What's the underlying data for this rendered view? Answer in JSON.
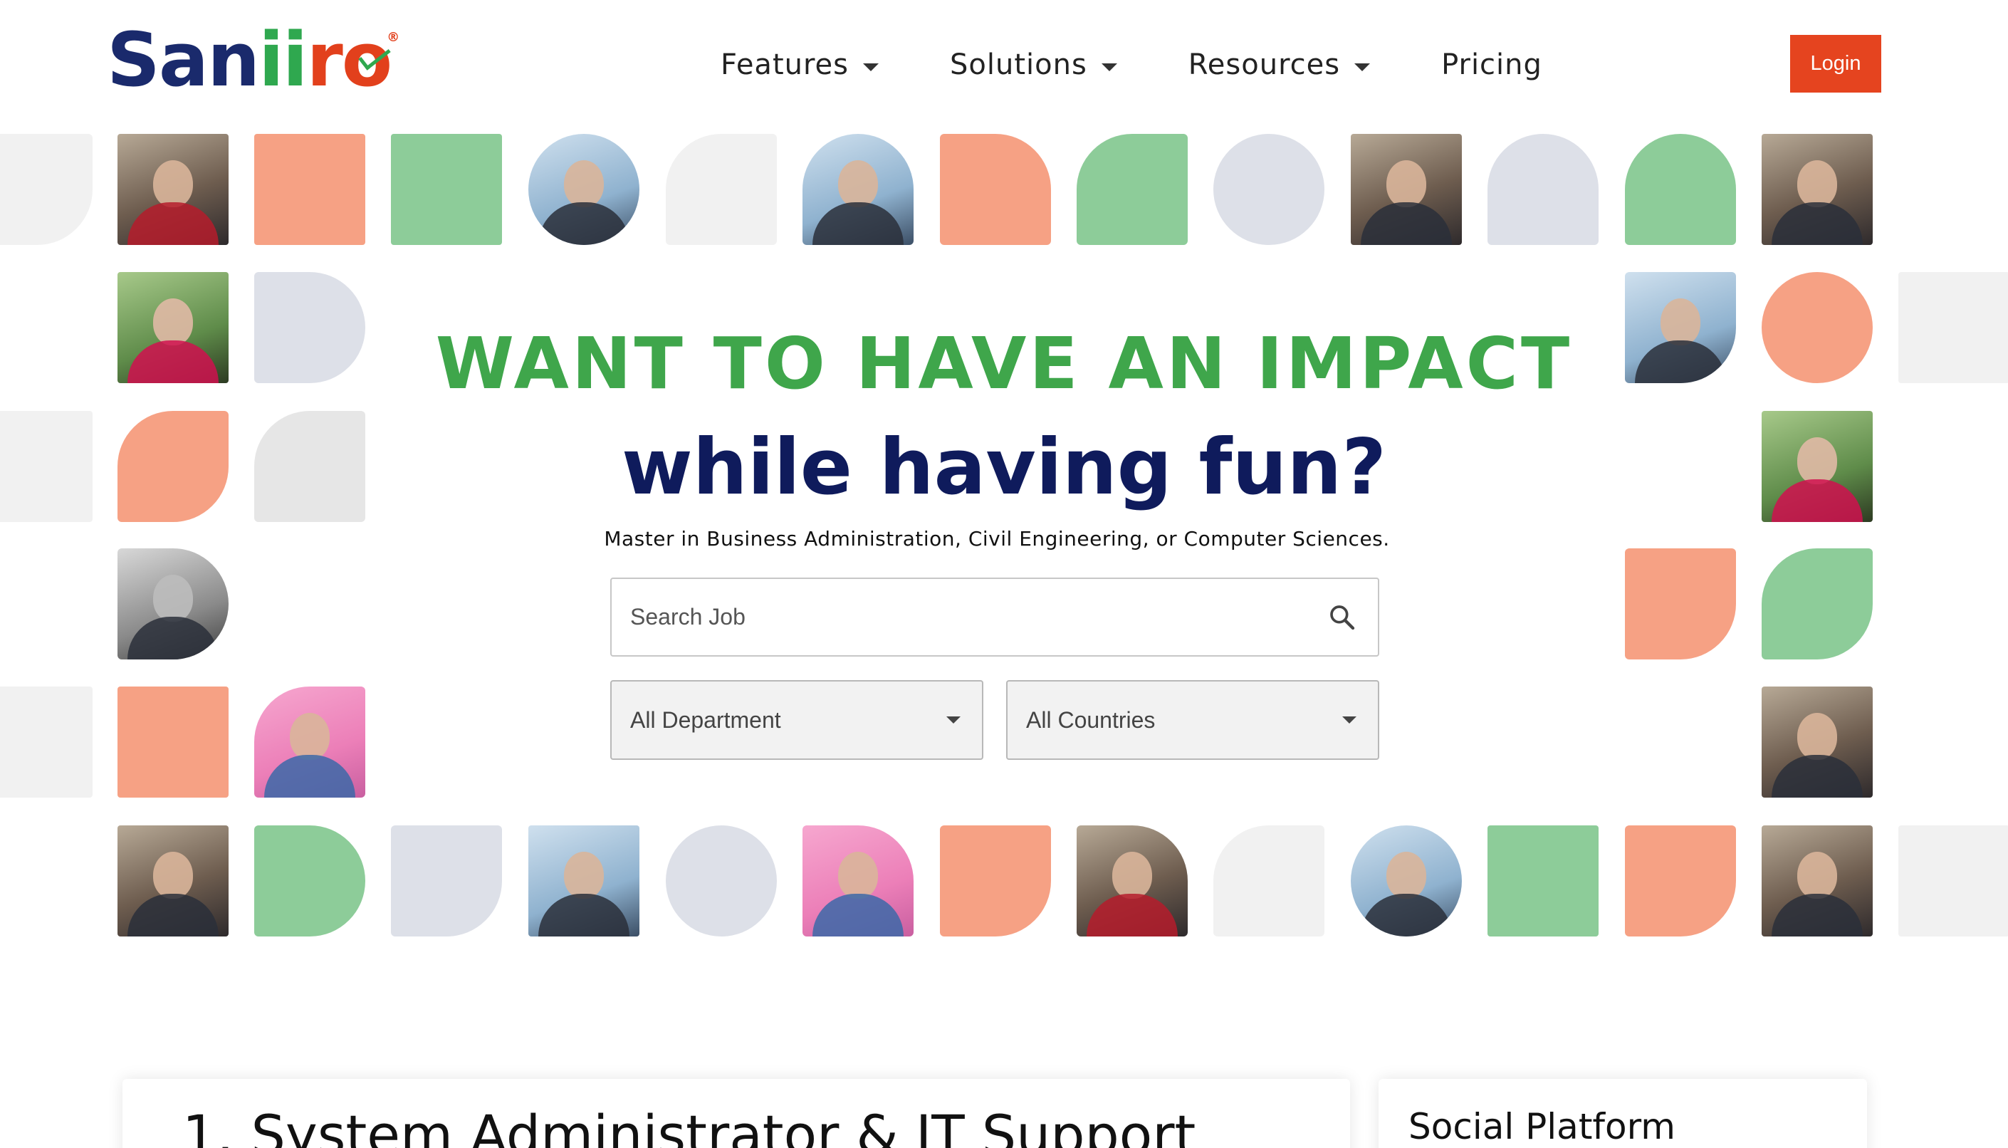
{
  "brand": {
    "name": "saniiro",
    "logo_text_parts": [
      "Sa",
      "n",
      "ii",
      "r",
      "o"
    ]
  },
  "nav": {
    "items": [
      {
        "label": "Features",
        "has_dropdown": true
      },
      {
        "label": "Solutions",
        "has_dropdown": true
      },
      {
        "label": "Resources",
        "has_dropdown": true
      },
      {
        "label": "Pricing",
        "has_dropdown": false
      }
    ],
    "login_label": "Login"
  },
  "hero": {
    "title": "WANT TO HAVE AN IMPACT",
    "subtitle": "while having fun?",
    "description": "Master in Business Administration, Civil Engineering, or Computer Sciences."
  },
  "search": {
    "placeholder": "Search Job",
    "value": ""
  },
  "filters": {
    "department": {
      "selected": "All Department"
    },
    "country": {
      "selected": "All Countries"
    }
  },
  "listing": {
    "first_job_title": "1. System Administrator & IT Support",
    "side_panel_title": "Social Platform"
  },
  "colors": {
    "brand_navy": "#0f1b5c",
    "brand_green": "#3fa64b",
    "accent_orange": "#e5441f",
    "tile_orange": "#f6a184",
    "tile_green": "#8dcc99",
    "tile_gray": "#dde0e8"
  }
}
